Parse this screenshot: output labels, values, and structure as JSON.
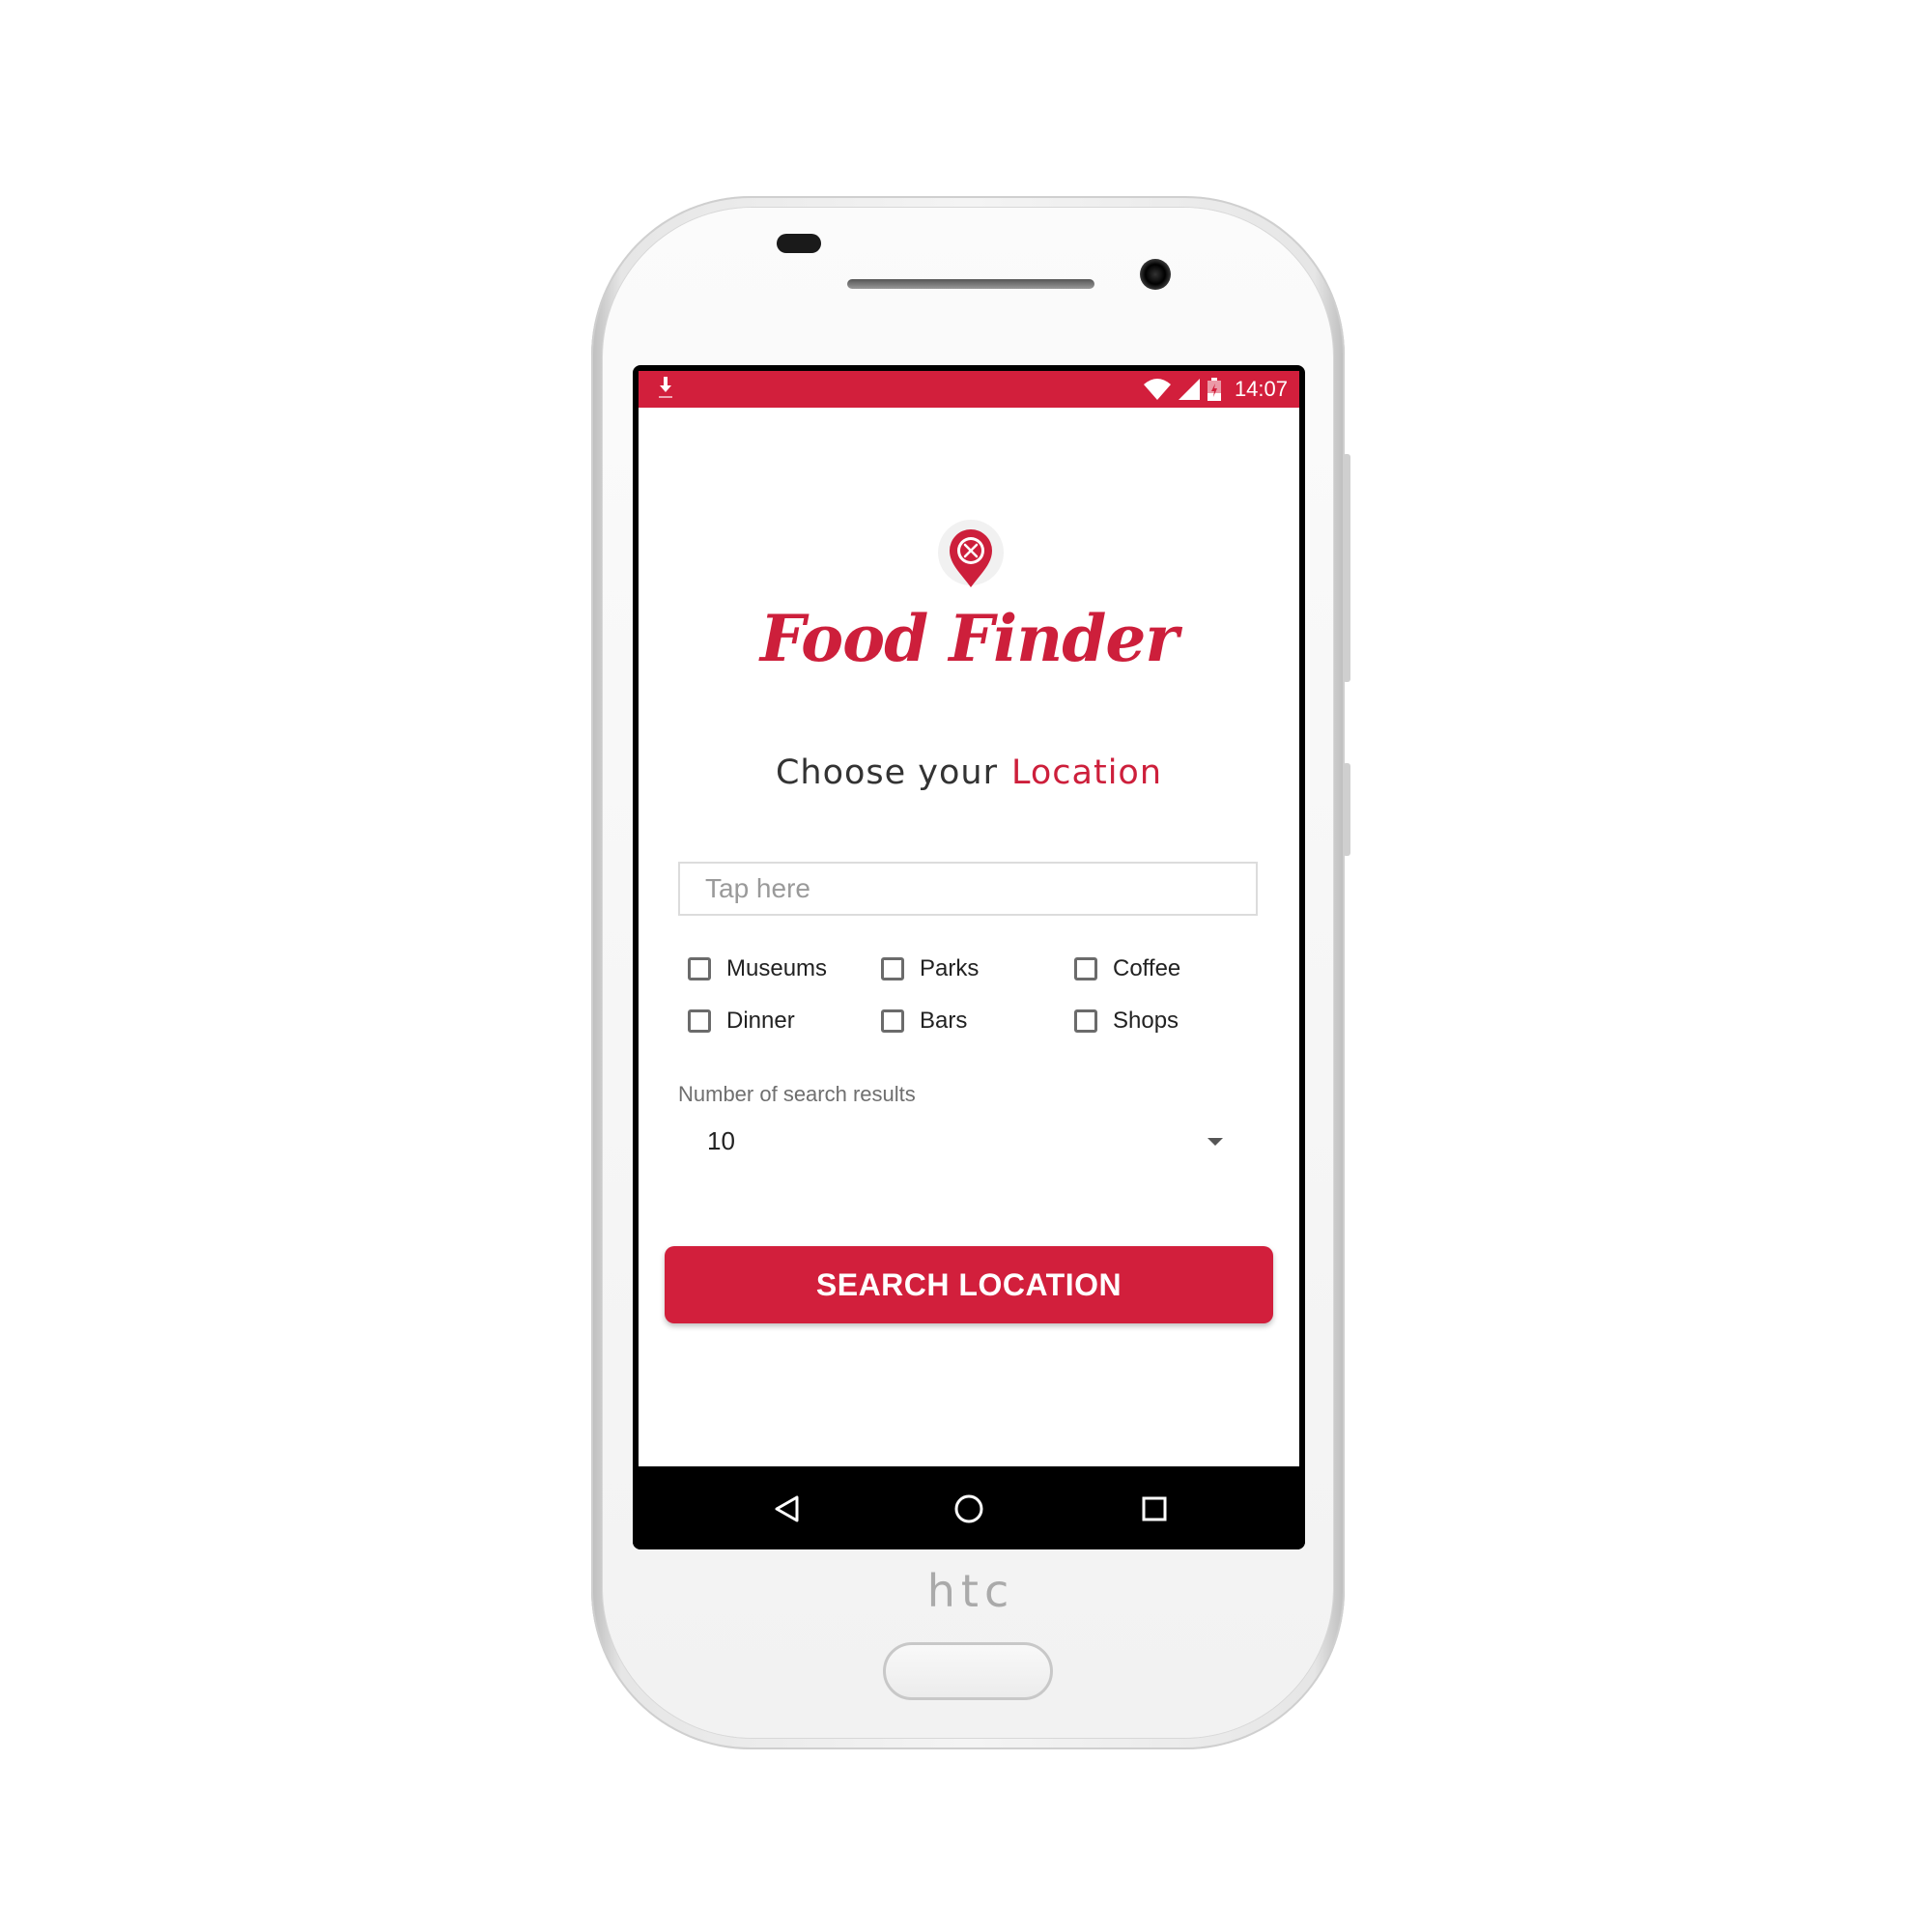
{
  "device": {
    "brand": "htc"
  },
  "status_bar": {
    "time": "14:07",
    "color": "#d21f3c",
    "icons": [
      "download-icon",
      "wifi-icon",
      "signal-icon",
      "battery-icon"
    ]
  },
  "app": {
    "title": "Food Finder",
    "logo_icon": "map-pin-fork-knife-icon",
    "accent_color": "#cd1f3b",
    "headline": {
      "prefix": "Choose your",
      "accent": "Location"
    },
    "search": {
      "placeholder": "Tap here",
      "value": ""
    },
    "categories": [
      {
        "label": "Museums",
        "checked": false
      },
      {
        "label": "Parks",
        "checked": false
      },
      {
        "label": "Coffee",
        "checked": false
      },
      {
        "label": "Dinner",
        "checked": false
      },
      {
        "label": "Bars",
        "checked": false
      },
      {
        "label": "Shops",
        "checked": false
      }
    ],
    "results": {
      "label": "Number of search results",
      "selected": "10"
    },
    "search_button_label": "SEARCH LOCATION"
  },
  "navigation": {
    "buttons": [
      "back-icon",
      "home-icon",
      "recents-icon"
    ]
  }
}
